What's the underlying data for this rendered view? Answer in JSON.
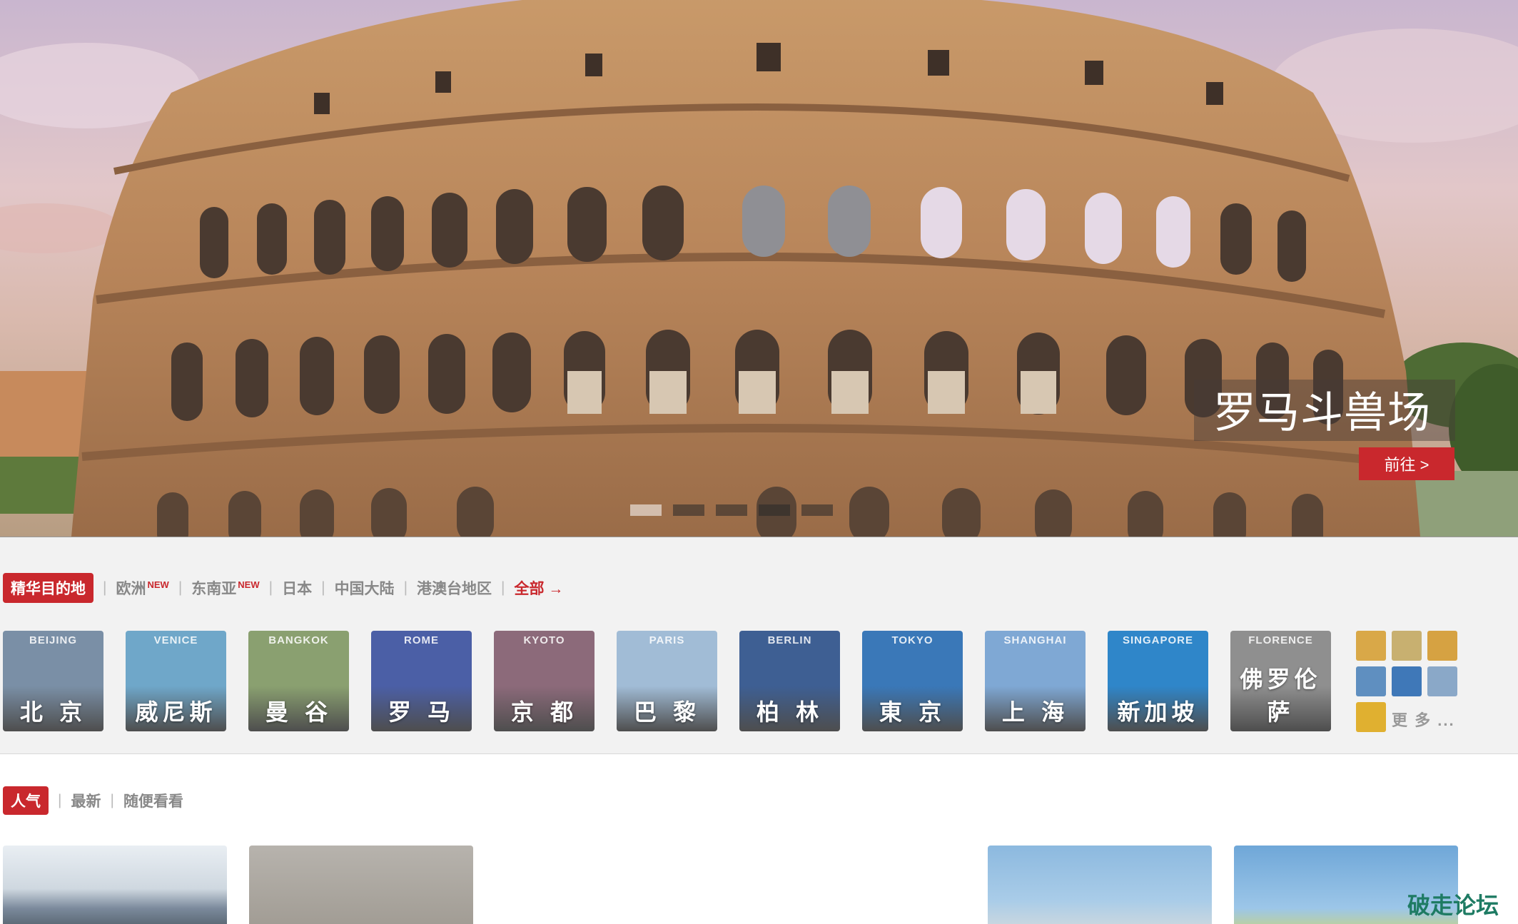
{
  "hero": {
    "title": "罗马斗兽场",
    "button_label": "前往 >",
    "slide_count": 5,
    "active_slide": 1
  },
  "destinations": {
    "filters": {
      "active": "精华目的地",
      "items": [
        {
          "label": "欧洲",
          "badge": "NEW"
        },
        {
          "label": "东南亚",
          "badge": "NEW"
        },
        {
          "label": "日本"
        },
        {
          "label": "中国大陆"
        },
        {
          "label": "港澳台地区"
        }
      ],
      "all_label": "全部 →"
    },
    "cards": [
      {
        "en": "BEIJING",
        "cn": "北 京",
        "color": "#7a8fa6"
      },
      {
        "en": "VENICE",
        "cn": "威尼斯",
        "color": "#6fa7c9"
      },
      {
        "en": "BANGKOK",
        "cn": "曼 谷",
        "color": "#8aa070"
      },
      {
        "en": "ROME",
        "cn": "罗 马",
        "color": "#4b5fa6"
      },
      {
        "en": "KYOTO",
        "cn": "京 都",
        "color": "#8c6a7a"
      },
      {
        "en": "PARIS",
        "cn": "巴 黎",
        "color": "#a1bcd6"
      },
      {
        "en": "BERLIN",
        "cn": "柏 林",
        "color": "#3e5f93"
      },
      {
        "en": "TOKYO",
        "cn": "東 京",
        "color": "#3a78b8"
      },
      {
        "en": "SHANGHAI",
        "cn": "上 海",
        "color": "#7fa8d4"
      },
      {
        "en": "SINGAPORE",
        "cn": "新加坡",
        "color": "#2f86c9"
      },
      {
        "en": "FLORENCE",
        "cn": "佛罗伦萨",
        "color": "#8f8f8f"
      }
    ],
    "more_label": "更 多 ...",
    "more_thumb_colors": [
      "#d9a848",
      "#c8b070",
      "#d6a242",
      "#5f8fc0",
      "#3f78b8",
      "#8aa8c8",
      "#e0b030"
    ]
  },
  "popular": {
    "active": "人气",
    "items": [
      "最新",
      "随便看看"
    ]
  },
  "watermark": "破走论坛"
}
